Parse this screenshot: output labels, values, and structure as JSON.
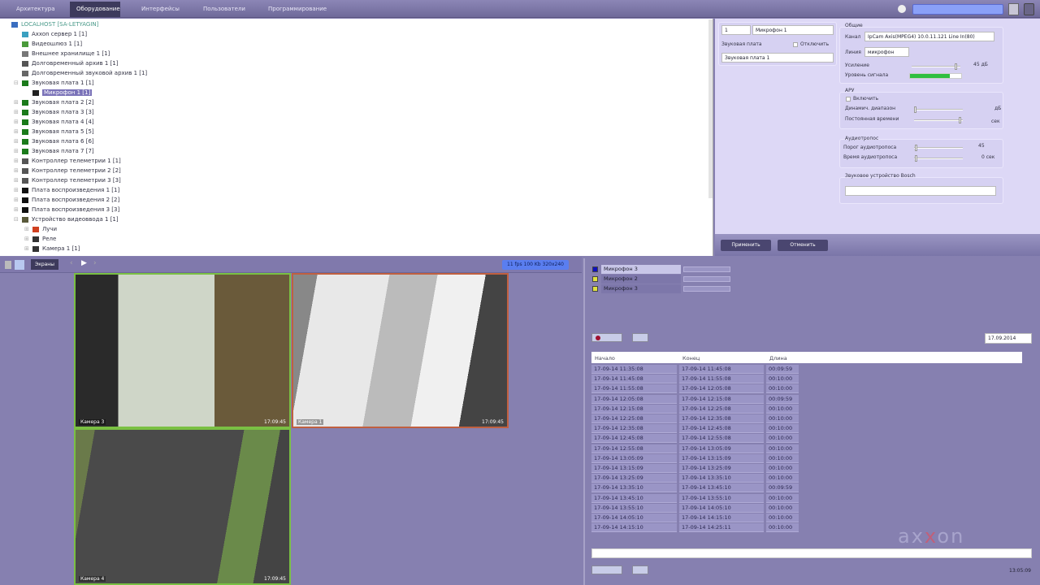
{
  "top_tabs": [
    {
      "label": "Архитектура"
    },
    {
      "label": "Оборудование",
      "active": true
    },
    {
      "label": "Интерфейсы"
    },
    {
      "label": "Пользователи"
    },
    {
      "label": "Программирование"
    }
  ],
  "tree": [
    {
      "label": "LOCALHOST [SA-LETYAGIN]",
      "level": 0,
      "icon": "server-icon",
      "color": "#3a6ec0"
    },
    {
      "label": "Axxon сервер 1 [1]",
      "level": 1,
      "icon": "globe-icon",
      "color": "#3aa0c0"
    },
    {
      "label": "Видеошлюз 1 [1]",
      "level": 1,
      "icon": "gateway-icon",
      "color": "#4a9a3a"
    },
    {
      "label": "Внешнее хранилище 1 [1]",
      "level": 1,
      "icon": "storage-icon",
      "color": "#777"
    },
    {
      "label": "Долговременный архив 1 [1]",
      "level": 1,
      "icon": "archive-icon",
      "color": "#555"
    },
    {
      "label": "Долговременный звуковой архив 1 [1]",
      "level": 1,
      "icon": "audio-archive-icon",
      "color": "#666"
    },
    {
      "label": "Звуковая плата 1 [1]",
      "level": 1,
      "icon": "sound-card-icon",
      "color": "#1a7a1a",
      "exp": "-"
    },
    {
      "label": "Микрофон 1 [1]",
      "level": 2,
      "icon": "microphone-icon",
      "color": "#222",
      "selected": true
    },
    {
      "label": "Звуковая плата 2 [2]",
      "level": 1,
      "icon": "sound-card-icon",
      "color": "#1a7a1a",
      "exp": "+"
    },
    {
      "label": "Звуковая плата 3 [3]",
      "level": 1,
      "icon": "sound-card-icon",
      "color": "#1a7a1a",
      "exp": "+"
    },
    {
      "label": "Звуковая плата 4 [4]",
      "level": 1,
      "icon": "sound-card-icon",
      "color": "#1a7a1a",
      "exp": "+"
    },
    {
      "label": "Звуковая плата 5 [5]",
      "level": 1,
      "icon": "sound-card-icon",
      "color": "#1a7a1a",
      "exp": "+"
    },
    {
      "label": "Звуковая плата 6 [6]",
      "level": 1,
      "icon": "sound-card-icon",
      "color": "#1a7a1a",
      "exp": "+"
    },
    {
      "label": "Звуковая плата 7 [7]",
      "level": 1,
      "icon": "sound-card-icon",
      "color": "#1a7a1a",
      "exp": "+"
    },
    {
      "label": "Контроллер телеметрии 1 [1]",
      "level": 1,
      "icon": "telemetry-icon",
      "color": "#555",
      "exp": "+"
    },
    {
      "label": "Контроллер телеметрии 2 [2]",
      "level": 1,
      "icon": "telemetry-icon",
      "color": "#555",
      "exp": "+"
    },
    {
      "label": "Контроллер телеметрии 3 [3]",
      "level": 1,
      "icon": "telemetry-icon",
      "color": "#555",
      "exp": "+"
    },
    {
      "label": "Плата воспроизведения 1 [1]",
      "level": 1,
      "icon": "playback-board-icon",
      "color": "#111",
      "exp": "+"
    },
    {
      "label": "Плата воспроизведения 2 [2]",
      "level": 1,
      "icon": "playback-board-icon",
      "color": "#111",
      "exp": "+"
    },
    {
      "label": "Плата воспроизведения 3 [3]",
      "level": 1,
      "icon": "playback-board-icon",
      "color": "#111",
      "exp": "+"
    },
    {
      "label": "Устройство видеоввода 1 [1]",
      "level": 1,
      "icon": "video-input-icon",
      "color": "#5a5a3a",
      "exp": "-"
    },
    {
      "label": "Лучи",
      "level": 2,
      "icon": "rays-icon",
      "color": "#d04020",
      "exp": "+"
    },
    {
      "label": "Реле",
      "level": 2,
      "icon": "relay-icon",
      "color": "#333",
      "exp": "+"
    },
    {
      "label": "Камера 1 [1]",
      "level": 2,
      "icon": "camera-icon",
      "color": "#333",
      "exp": "+"
    }
  ],
  "props": {
    "id_value": "1",
    "name_value": "Микрофон 1",
    "sound_card_label": "Звуковая плата",
    "disable_label": "Отключить",
    "sound_card_value": "Звуковая плата 1",
    "general_title": "Общие",
    "channel_label": "Канал",
    "channel_value": "IpCam Axis(MPEG4) 10.0.11.121 Line In(80)",
    "line_label": "Линия",
    "line_value": "микрофон",
    "gain_label": "Усиление",
    "gain_value": "45",
    "gain_unit": "дБ",
    "gain_fraction": 0.92,
    "level_label": "Уровень сигнала",
    "level_fraction": 0.78,
    "agc_title": "АРУ",
    "agc_enable": "Включить",
    "dyn_range_label": "Динамич. диапазон",
    "dyn_range_unit": "дБ",
    "time_const_label": "Постоянная времени",
    "time_const_unit": "сек",
    "vox_title": "Аудиотропос",
    "vox_threshold_label": "Порог аудиотропоса",
    "vox_threshold_value": "45",
    "vox_time_label": "Время аудиотропоса",
    "vox_time_value": "0",
    "vox_time_unit": "сек",
    "bosch_title": "Звуковое устройство Bosch",
    "bosch_value": "",
    "apply": "Применить",
    "cancel": "Отменить"
  },
  "camtool": {
    "screens": "Экраны",
    "info": "11 fps 100 Kb 320x240"
  },
  "cameras": [
    {
      "label": "Камера 3",
      "time": "17:09:45",
      "border": "#7ac043"
    },
    {
      "label": "Камера 1",
      "time": "17:09:45",
      "border": "#c06040"
    },
    {
      "label": "Камера 4",
      "time": "17:09:45",
      "border": "#7ac043"
    }
  ],
  "mics": [
    {
      "name": "Микрофон 3",
      "color": "#1010c0"
    },
    {
      "name": "Микрофон 2",
      "color": "#e0e040"
    },
    {
      "name": "Микрофон 3",
      "color": "#e0e040"
    }
  ],
  "date_value": "17.09.2014",
  "table": {
    "headers": [
      "Начало",
      "Конец",
      "Длина"
    ],
    "rows": [
      [
        "17-09-14 11:35:08",
        "17-09-14 11:45:08",
        "00:09:59"
      ],
      [
        "17-09-14 11:45:08",
        "17-09-14 11:55:08",
        "00:10:00"
      ],
      [
        "17-09-14 11:55:08",
        "17-09-14 12:05:08",
        "00:10:00"
      ],
      [
        "17-09-14 12:05:08",
        "17-09-14 12:15:08",
        "00:09:59"
      ],
      [
        "17-09-14 12:15:08",
        "17-09-14 12:25:08",
        "00:10:00"
      ],
      [
        "17-09-14 12:25:08",
        "17-09-14 12:35:08",
        "00:10:00"
      ],
      [
        "17-09-14 12:35:08",
        "17-09-14 12:45:08",
        "00:10:00"
      ],
      [
        "17-09-14 12:45:08",
        "17-09-14 12:55:08",
        "00:10:00"
      ],
      [
        "17-09-14 12:55:08",
        "17-09-14 13:05:09",
        "00:10:00"
      ],
      [
        "17-09-14 13:05:09",
        "17-09-14 13:15:09",
        "00:10:00"
      ],
      [
        "17-09-14 13:15:09",
        "17-09-14 13:25:09",
        "00:10:00"
      ],
      [
        "17-09-14 13:25:09",
        "17-09-14 13:35:10",
        "00:10:00"
      ],
      [
        "17-09-14 13:35:10",
        "17-09-14 13:45:10",
        "00:09:59"
      ],
      [
        "17-09-14 13:45:10",
        "17-09-14 13:55:10",
        "00:10:00"
      ],
      [
        "17-09-14 13:55:10",
        "17-09-14 14:05:10",
        "00:10:00"
      ],
      [
        "17-09-14 14:05:10",
        "17-09-14 14:15:10",
        "00:10:00"
      ],
      [
        "17-09-14 14:15:10",
        "17-09-14 14:25:11",
        "00:10:00"
      ]
    ]
  },
  "clock": "13:05:09",
  "logo": "axxon"
}
